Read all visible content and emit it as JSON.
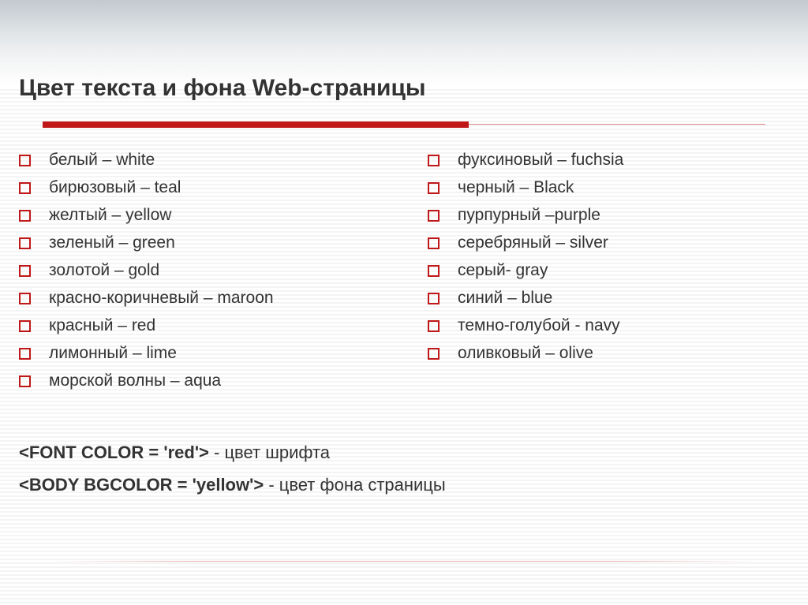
{
  "title": "Цвет текста и фона Web-страницы",
  "colors_left": [
    "белый – white",
    "бирюзовый – teal",
    "желтый – yellow",
    "зеленый – green",
    "золотой – gold",
    "красно-коричневый – maroon",
    "красный – red",
    "лимонный – lime",
    "морской волны – aqua"
  ],
  "colors_right": [
    "фуксиновый – fuchsia",
    "черный – Black",
    "пурпурный –purple",
    "серебряный – silver",
    "серый- gray",
    "синий –  blue",
    "темно-голубой - navy",
    "оливковый – olive"
  ],
  "examples": {
    "font_code": "<FONT COLOR = 'red'>",
    "font_desc": " - цвет шрифта",
    "body_code": "<BODY BGCOLOR = 'yellow'>",
    "body_desc": "  - цвет фона страницы"
  }
}
